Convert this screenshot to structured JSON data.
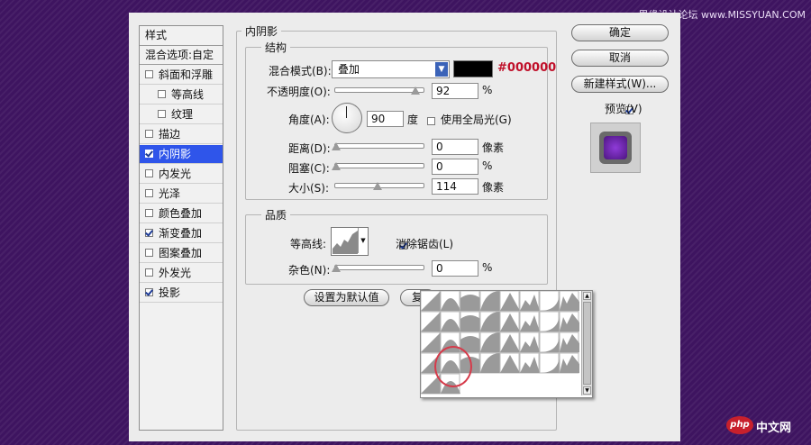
{
  "watermark": "思缘设计论坛 www.MISSYUAN.COM",
  "styles_panel": {
    "header": "样式",
    "blend_options": "混合选项:自定",
    "items": [
      {
        "label": "斜面和浮雕",
        "checked": false,
        "indent": false
      },
      {
        "label": "等高线",
        "checked": false,
        "indent": true
      },
      {
        "label": "纹理",
        "checked": false,
        "indent": true
      },
      {
        "label": "描边",
        "checked": false,
        "indent": false
      },
      {
        "label": "内阴影",
        "checked": true,
        "indent": false,
        "selected": true
      },
      {
        "label": "内发光",
        "checked": false,
        "indent": false
      },
      {
        "label": "光泽",
        "checked": false,
        "indent": false
      },
      {
        "label": "颜色叠加",
        "checked": false,
        "indent": false
      },
      {
        "label": "渐变叠加",
        "checked": true,
        "indent": false
      },
      {
        "label": "图案叠加",
        "checked": false,
        "indent": false
      },
      {
        "label": "外发光",
        "checked": false,
        "indent": false
      },
      {
        "label": "投影",
        "checked": true,
        "indent": false
      }
    ]
  },
  "inner_shadow": {
    "title": "内阴影",
    "structure": {
      "title": "结构",
      "blend_mode_label": "混合模式(B):",
      "blend_mode_value": "叠加",
      "color_hex": "#000000",
      "opacity_label": "不透明度(O):",
      "opacity_value": "92",
      "opacity_unit": "%",
      "angle_label": "角度(A):",
      "angle_value": "90",
      "angle_unit": "度",
      "global_light_label": "使用全局光(G)",
      "global_light_checked": false,
      "distance_label": "距离(D):",
      "distance_value": "0",
      "distance_unit": "像素",
      "choke_label": "阻塞(C):",
      "choke_value": "0",
      "choke_unit": "%",
      "size_label": "大小(S):",
      "size_value": "114",
      "size_unit": "像素"
    },
    "quality": {
      "title": "品质",
      "contour_label": "等高线:",
      "antialias_label": "消除锯齿(L)",
      "antialias_checked": true,
      "noise_label": "杂色(N):",
      "noise_value": "0",
      "noise_unit": "%"
    },
    "default_button": "设置为默认值",
    "reset_button_partial": "复"
  },
  "buttons": {
    "ok": "确定",
    "cancel": "取消",
    "new_style": "新建样式(W)...",
    "preview_label": "预览(V)",
    "preview_checked": true
  },
  "logo": {
    "text": "php 中文网"
  }
}
